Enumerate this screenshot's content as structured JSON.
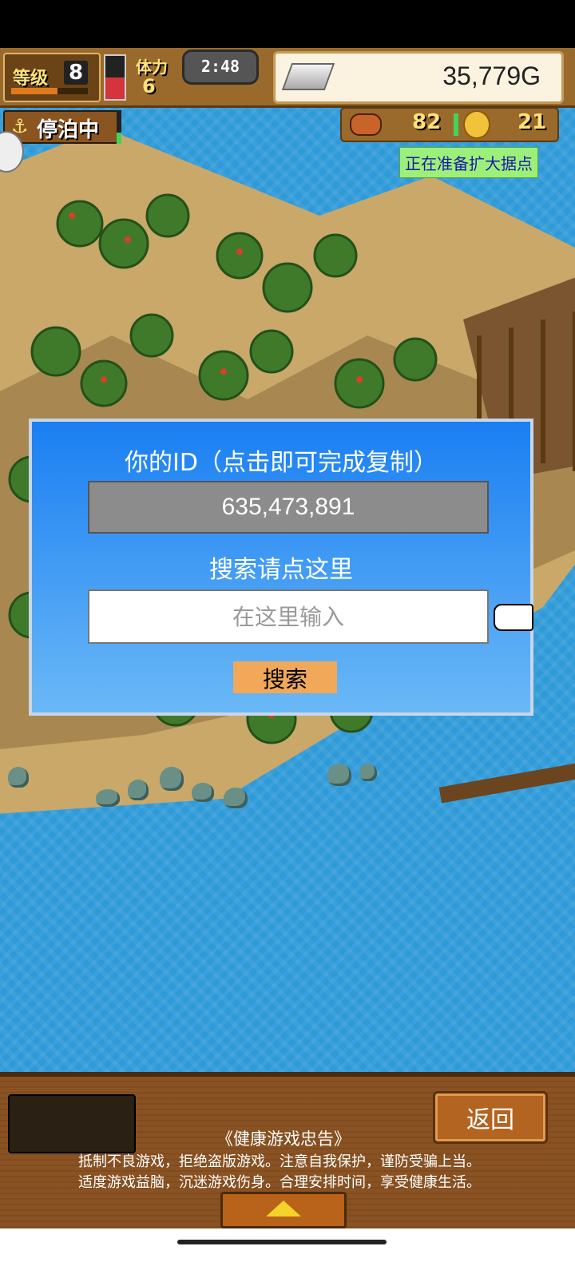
{
  "hud": {
    "level_label": "等级",
    "level_value": "8",
    "xp_fraction": 0.6,
    "stamina_fraction": 0.5,
    "stamina_label": "体力",
    "stamina_value": "6",
    "timer": "2:48",
    "gold": "35,779G",
    "docked_label": "停泊中",
    "food_value": "82",
    "coin_value": "21",
    "expand_notice": "正在准备扩大据点"
  },
  "dialog": {
    "title": "你的ID（点击即可完成复制）",
    "player_id": "635,473,891",
    "search_label": "搜索请点这里",
    "search_placeholder": "在这里输入",
    "search_value": "",
    "search_button": "搜索"
  },
  "footer": {
    "back_button": "返回",
    "notice_title": "《健康游戏忠告》",
    "notice_line1": "抵制不良游戏，拒绝盗版游戏。注意自我保护，谨防受骗上当。",
    "notice_line2": "适度游戏益脑，沉迷游戏伤身。合理安排时间，享受健康生活。"
  },
  "icons": {
    "anchor": "anchor-icon",
    "silver": "silver-bar-icon",
    "food": "meat-icon",
    "coin": "coin-icon",
    "pointer": "pointing-hand-icon",
    "arrow": "arrow-up-icon"
  },
  "colors": {
    "water": "#2f9ad8",
    "dialog_top": "#1a7ff2",
    "dialog_bottom": "#6ab8f6",
    "search_button": "#f1a859",
    "wood": "#8a5222"
  }
}
